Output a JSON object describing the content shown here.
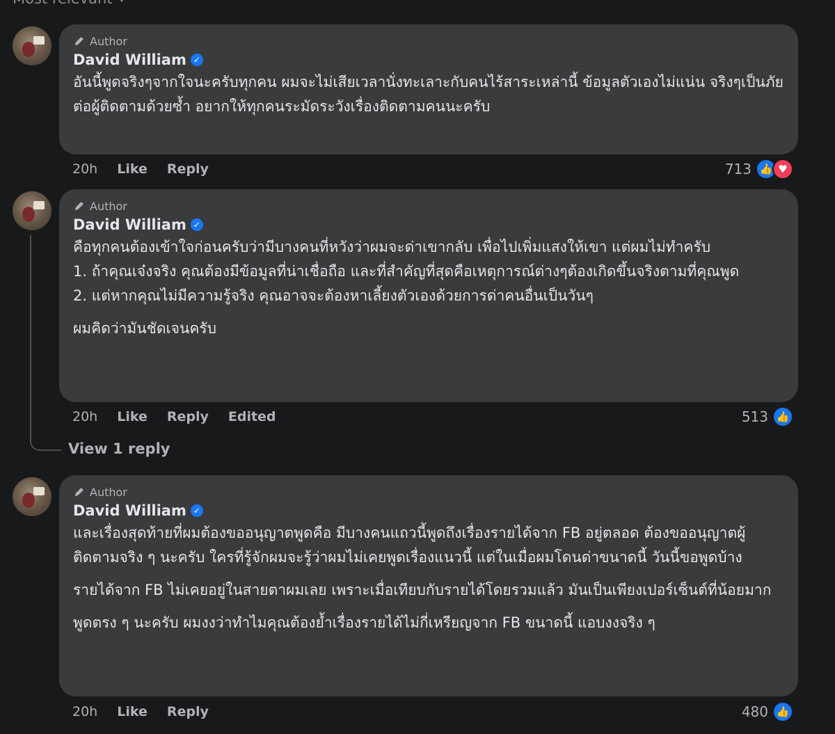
{
  "sort": {
    "label": "Most relevant"
  },
  "comments": [
    {
      "badge": "Author",
      "name": "David William",
      "paragraphs": [
        "อันนี้พูดจริงๆจากใจนะครับทุกคน ผมจะไม่เสียเวลานั่งทะเลาะกับคนไร้สาระเหล่านี้ ข้อมูลตัวเองไม่แน่น จริงๆเป็นภัยต่อผู้ติดตามด้วยซ้ำ อยากให้ทุกคนระมัดระวังเรื่องติดตามคนนะครับ ￼￼￼￼￼"
      ],
      "time": "20h",
      "like": "Like",
      "reply": "Reply",
      "reaction_count": "713"
    },
    {
      "badge": "Author",
      "name": "David William",
      "paragraphs": [
        "คือทุกคนต้องเข้าใจก่อนครับว่ามีบางคนที่หวังว่าผมจะด่าเขากลับ เพื่อไปเพิ่มแสงให้เขา แต่ผมไม่ทำครับ",
        "1. ถ้าคุณเจ๋งจริง คุณต้องมีข้อมูลที่น่าเชื่อถือ และที่สำคัญที่สุดคือเหตุการณ์ต่างๆ￼ต้องเกิดขึ้นจริงตามที่คุณพูด",
        "2. แต่หากคุณไม่มีความรู้จริง คุณอาจจะต้องหาเลี้ยงตัวเองด้วยการด่าคนอื่นเป็น￼วันๆ￼",
        "ผมคิดว่ามันชัดเจนครับ"
      ],
      "time": "20h",
      "like": "Like",
      "reply": "Reply",
      "edited": "Edited",
      "reaction_count": "513",
      "view_replies": "View 1 reply"
    },
    {
      "badge": "Author",
      "name": "David William",
      "paragraphs": [
        "และเรื่องสุดท้ายที่ผมต้องขออนุญาตพูดคือ มีบางคนแถวนี้พูดถึงเรื่องรายได้จาก FB อยู่ตลอด ต้องขออนุญาตผู้ติดตามจริง ๆ นะครับ ใครที่รู้จักผมจะรู้ว่าผมไม่เคยพูดเรื่องแนวนี้ แต่ในเมื่อผมโดนด่าขนาดนี้ วันนี้ขอพูดบ้าง",
        "รายได้จาก FB ไม่เคยอยู่ในสายตาผมเลย เพราะเมื่อเทียบกับรายได้โดยรวมแล้ว มันเป็นเพียงเปอร์เซ็นต์ที่น้อยมาก",
        "พูดตรง ๆ นะครับ ผมงงว่าทำไมคุณต้องย้ำเรื่องรายได้ไม่กี่เหรียญจาก FB ขนาดนี้ แอบงงจริง ๆ"
      ],
      "time": "20h",
      "like": "Like",
      "reply": "Reply",
      "reaction_count": "480"
    }
  ],
  "colors": {
    "background": "#18191a",
    "bubble": "#3a3b3c",
    "like": "#1877f2",
    "love": "#f33e58",
    "muted_text": "#b0b3b8"
  },
  "icons": [
    "pencil-icon",
    "verified-icon",
    "like-icon",
    "love-icon",
    "chevron-down-icon"
  ]
}
